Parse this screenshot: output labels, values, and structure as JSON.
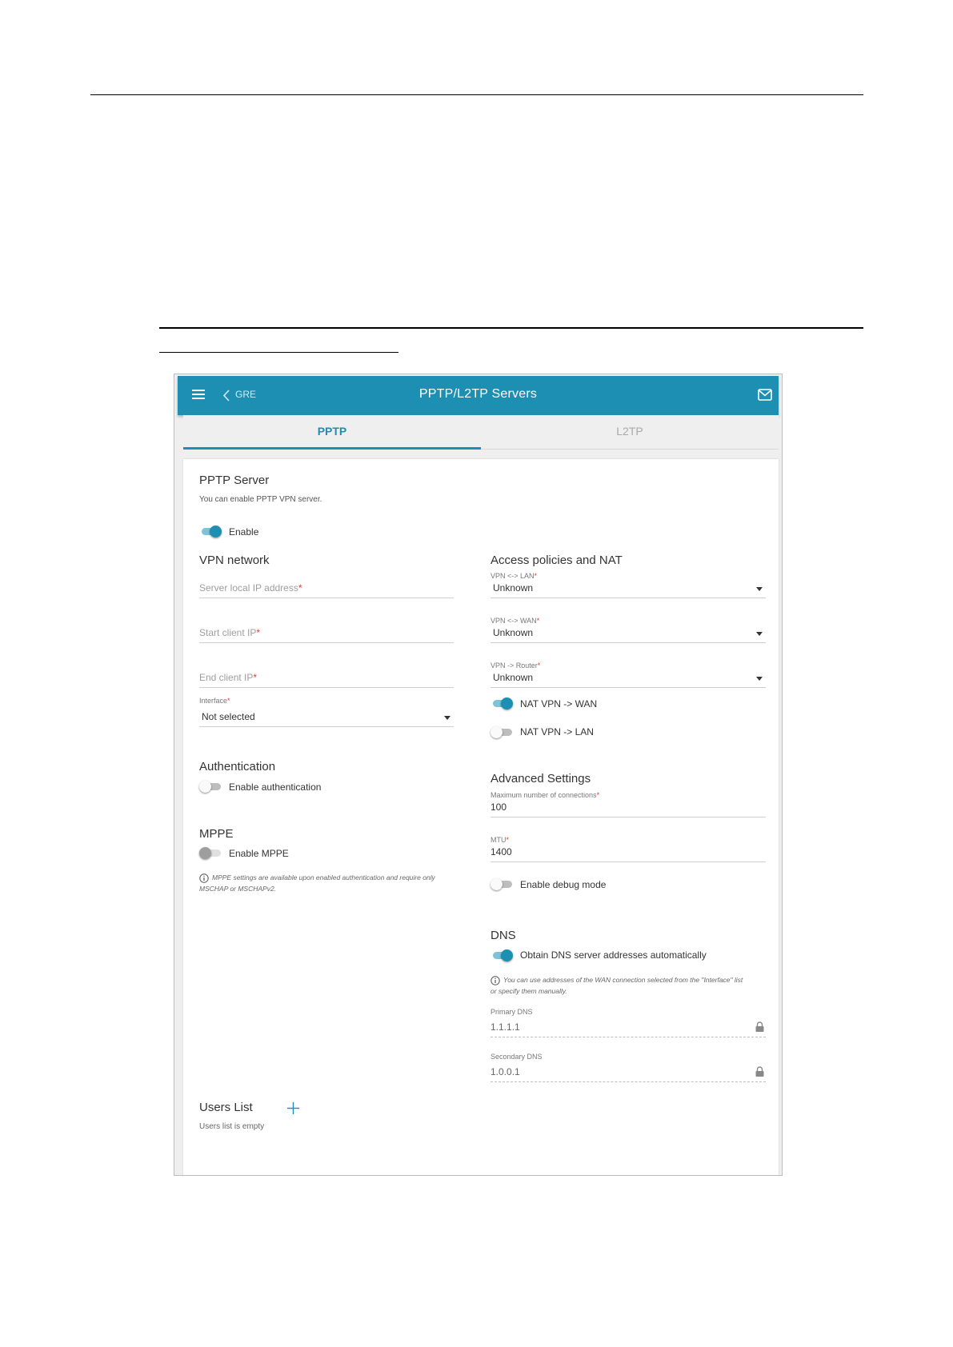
{
  "header": {
    "back_label": "GRE",
    "title": "PPTP/L2TP Servers"
  },
  "tabs": [
    {
      "label": "PPTP",
      "active": true
    },
    {
      "label": "L2TP",
      "active": false
    }
  ],
  "server": {
    "title": "PPTP Server",
    "description": "You can enable PPTP VPN server.",
    "enable_label": "Enable",
    "enabled": true
  },
  "vpn_network": {
    "title": "VPN network",
    "server_ip_placeholder": "Server local IP address",
    "start_ip_placeholder": "Start client IP",
    "end_ip_placeholder": "End client IP",
    "interface_label": "Interface",
    "interface_value": "Not selected"
  },
  "access": {
    "title": "Access policies and NAT",
    "vpn_lan_label": "VPN <-> LAN",
    "vpn_lan_value": "Unknown",
    "vpn_wan_label": "VPN <-> WAN",
    "vpn_wan_value": "Unknown",
    "vpn_router_label": "VPN -> Router",
    "vpn_router_value": "Unknown",
    "nat_wan_label": "NAT VPN -> WAN",
    "nat_wan_on": true,
    "nat_lan_label": "NAT VPN -> LAN",
    "nat_lan_on": false
  },
  "authentication": {
    "title": "Authentication",
    "enable_label": "Enable authentication",
    "enabled": false
  },
  "mppe": {
    "title": "MPPE",
    "enable_label": "Enable MPPE",
    "enabled": false,
    "note_line1": "MPPE settings are available upon enabled authentication and require only",
    "note_line2": "MSCHAP or MSCHAPv2."
  },
  "advanced": {
    "title": "Advanced Settings",
    "max_conn_label": "Maximum number of connections",
    "max_conn_value": "100",
    "mtu_label": "MTU",
    "mtu_value": "1400",
    "debug_label": "Enable debug mode",
    "debug_on": false
  },
  "dns": {
    "title": "DNS",
    "auto_label": "Obtain DNS server addresses automatically",
    "auto_on": true,
    "note_line1": "You can use addresses of the WAN connection selected from the \"Interface\" list",
    "note_line2": "or specify them manually.",
    "primary_label": "Primary DNS",
    "primary_value": "1.1.1.1",
    "secondary_label": "Secondary DNS",
    "secondary_value": "1.0.0.1"
  },
  "users": {
    "title": "Users List",
    "empty_text": "Users list is empty"
  },
  "required_mark": "*",
  "colors": {
    "accent": "#1c8fb2",
    "required": "#e53935"
  }
}
